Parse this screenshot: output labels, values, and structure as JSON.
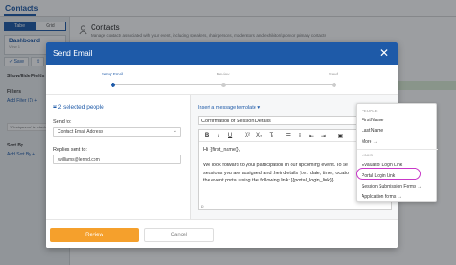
{
  "app": {
    "title": "Contacts",
    "view_toggle": [
      "Table",
      "Grid"
    ],
    "dashboard": {
      "title": "Dashboard",
      "subtitle": "View 1",
      "save_label": "Save"
    },
    "show_hide_label": "Show/Hide Fields",
    "filters_label": "Filters",
    "add_filter_label": "Add Filter (1) +",
    "filter_chip": "\"Chairperson\" is check...",
    "sort_label": "Sort By",
    "add_sort_label": "Add Sort By +",
    "contacts_heading": "Contacts",
    "contacts_description": "Manage contacts associated with your event, including speakers, chairpersons, moderators, and exhibitor/sponsor primary contacts"
  },
  "modal": {
    "title": "Send Email",
    "close_icon": "close-icon",
    "steps": [
      "Setup Email",
      "Review",
      "Send"
    ],
    "active_step": 0,
    "selected_people": "2 selected people",
    "send_to_label": "Send to:",
    "send_to_value": "Contact Email Address",
    "replies_label": "Replies sent to:",
    "replies_value": "jwilliams@lennd.com",
    "template_link": "Insert a message template",
    "subject": "Confirmation of Session Details",
    "toolbar_icons": [
      "bold-icon",
      "italic-icon",
      "underline-icon",
      "superscript-icon",
      "subscript-icon",
      "clear-format-icon",
      "bulleted-list-icon",
      "numbered-list-icon",
      "outdent-icon",
      "indent-icon",
      "image-icon"
    ],
    "toolbar_glyphs": [
      "B",
      "I",
      "U",
      "X²",
      "X₂",
      "T̸",
      "☰",
      "≡",
      "⇤",
      "⇥",
      "▣"
    ],
    "body_lines": [
      "Hi {{first_name}},",
      "",
      "We look forward to your participation in our upcoming event. To se",
      "sessions you are assigned and their details (i.e., date, time, locatio",
      "the event portal using the following link: {{portal_login_link}}"
    ],
    "editor_footer": "p",
    "review_label": "Review",
    "cancel_label": "Cancel"
  },
  "menu": {
    "people_header": "PEOPLE",
    "people_items": [
      "First Name",
      "Last Name",
      "More →"
    ],
    "links_header": "LINKS",
    "links_items": [
      "Evaluator Login Link",
      "Portal Login Link",
      "Session Submission Forms →",
      "Application forms →"
    ],
    "highlighted_item": "Portal Login Link"
  },
  "colors": {
    "brand": "#1e5aa8",
    "accent": "#f5a02c",
    "highlight": "#c838c8"
  }
}
